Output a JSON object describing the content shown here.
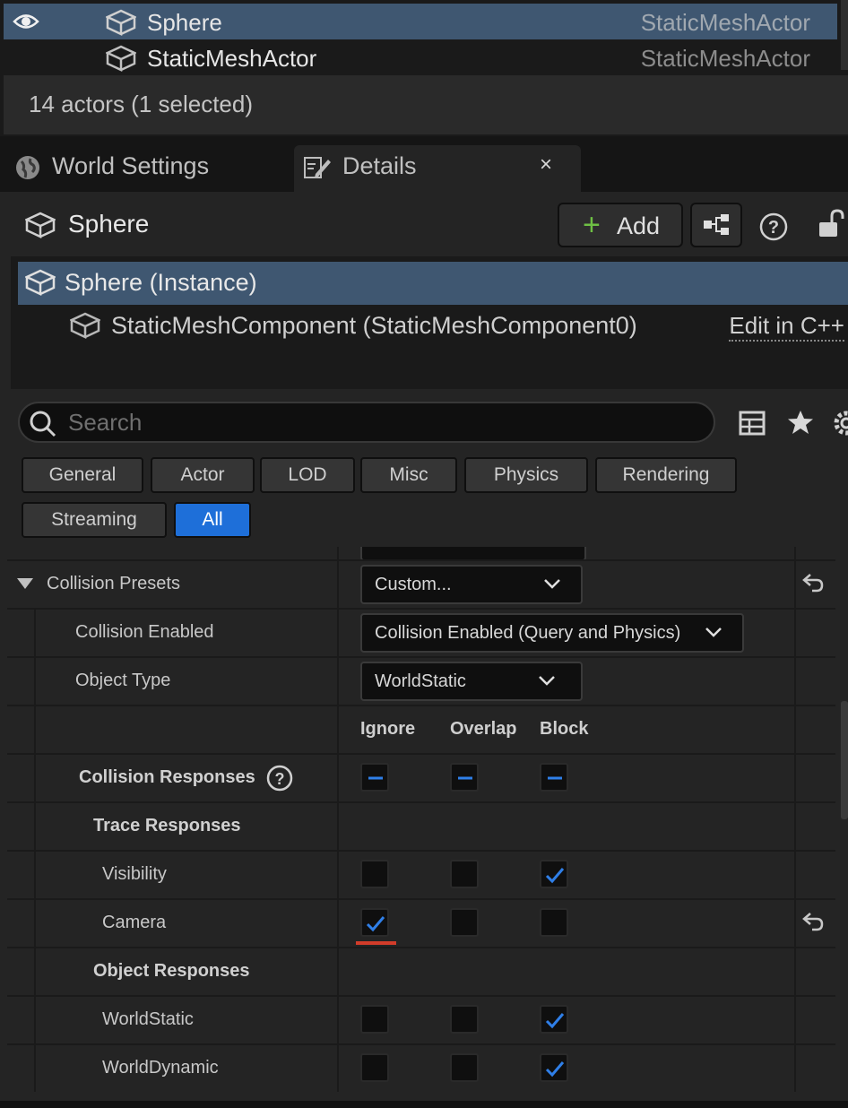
{
  "outliner": {
    "rows": [
      {
        "name": "Sphere",
        "type": "StaticMeshActor",
        "selected": true
      },
      {
        "name": "StaticMeshActor",
        "type": "StaticMeshActor",
        "selected": false
      }
    ],
    "status": "14 actors (1 selected)"
  },
  "tabs": [
    {
      "label": "World Settings",
      "icon": "globe-icon"
    },
    {
      "label": "Details",
      "icon": "edit-icon",
      "active": true,
      "close": "×"
    }
  ],
  "details": {
    "actor_name": "Sphere",
    "add_label": "Add",
    "components": [
      {
        "label": "Sphere (Instance)",
        "selected": true
      },
      {
        "label": "StaticMeshComponent (StaticMeshComponent0)",
        "selected": false
      }
    ],
    "edit_cpp": "Edit in C++",
    "search_placeholder": "Search",
    "categories": [
      "General",
      "Actor",
      "LOD",
      "Misc",
      "Physics",
      "Rendering",
      "Streaming",
      "All"
    ],
    "active_category": "All"
  },
  "properties": {
    "collision_presets": {
      "label": "Collision Presets",
      "value": "Custom..."
    },
    "collision_enabled": {
      "label": "Collision Enabled",
      "value": "Collision Enabled (Query and Physics)"
    },
    "object_type": {
      "label": "Object Type",
      "value": "WorldStatic"
    },
    "columns": {
      "ignore": "Ignore",
      "overlap": "Overlap",
      "block": "Block"
    },
    "collision_responses": "Collision Responses",
    "trace_responses": "Trace Responses",
    "object_responses": "Object Responses",
    "channels": [
      {
        "label": "Visibility",
        "state": "block"
      },
      {
        "label": "Camera",
        "state": "ignore"
      },
      {
        "label": "WorldStatic",
        "state": "block"
      },
      {
        "label": "WorldDynamic",
        "state": "block"
      }
    ]
  },
  "colors": {
    "accent": "#1e6fd9",
    "selection": "#3f5771",
    "check": "#2f7fe8",
    "add_plus": "#6ec044",
    "modified_underline": "#d23c2a"
  }
}
